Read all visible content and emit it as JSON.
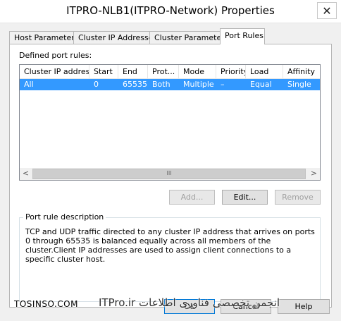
{
  "window": {
    "title": "ITPRO-NLB1(ITPRO-Network) Properties",
    "close_glyph": "✕"
  },
  "tabs": [
    {
      "label": "Host Parameters",
      "active": false
    },
    {
      "label": "Cluster IP Addresses",
      "active": false
    },
    {
      "label": "Cluster Parameters",
      "active": false
    },
    {
      "label": "Port Rules",
      "active": true
    }
  ],
  "port_rules": {
    "list_label": "Defined port rules:",
    "columns": [
      "Cluster IP address",
      "Start",
      "End",
      "Prot...",
      "Mode",
      "Priority",
      "Load",
      "Affinity"
    ],
    "rows": [
      {
        "cluster_ip": "All",
        "start": "0",
        "end": "65535",
        "protocol": "Both",
        "mode": "Multiple",
        "priority": "–",
        "load": "Equal",
        "affinity": "Single",
        "selected": true
      }
    ],
    "scrollbar": {
      "left_arrow": "<",
      "right_arrow": ">",
      "thumb_grip": "III"
    }
  },
  "actions": {
    "add_label": "Add...",
    "edit_label": "Edit...",
    "remove_label": "Remove"
  },
  "description": {
    "legend": "Port rule description",
    "text": "TCP and UDP traffic directed to any cluster IP address that arrives on ports 0 through 65535 is balanced equally across all members of the cluster.Client IP addresses are used to assign client connections to a specific cluster host."
  },
  "dialog_buttons": {
    "ok_label": "OK",
    "cancel_label": "Cancel",
    "help_label": "Help"
  },
  "watermark": {
    "left_text": "TOSINSO.COM",
    "right_text": "انجمن تخصصی فناوری اطلاعات ITPro.ir"
  },
  "colors": {
    "selection": "#3399ff",
    "default_button_border": "#0078d7"
  }
}
